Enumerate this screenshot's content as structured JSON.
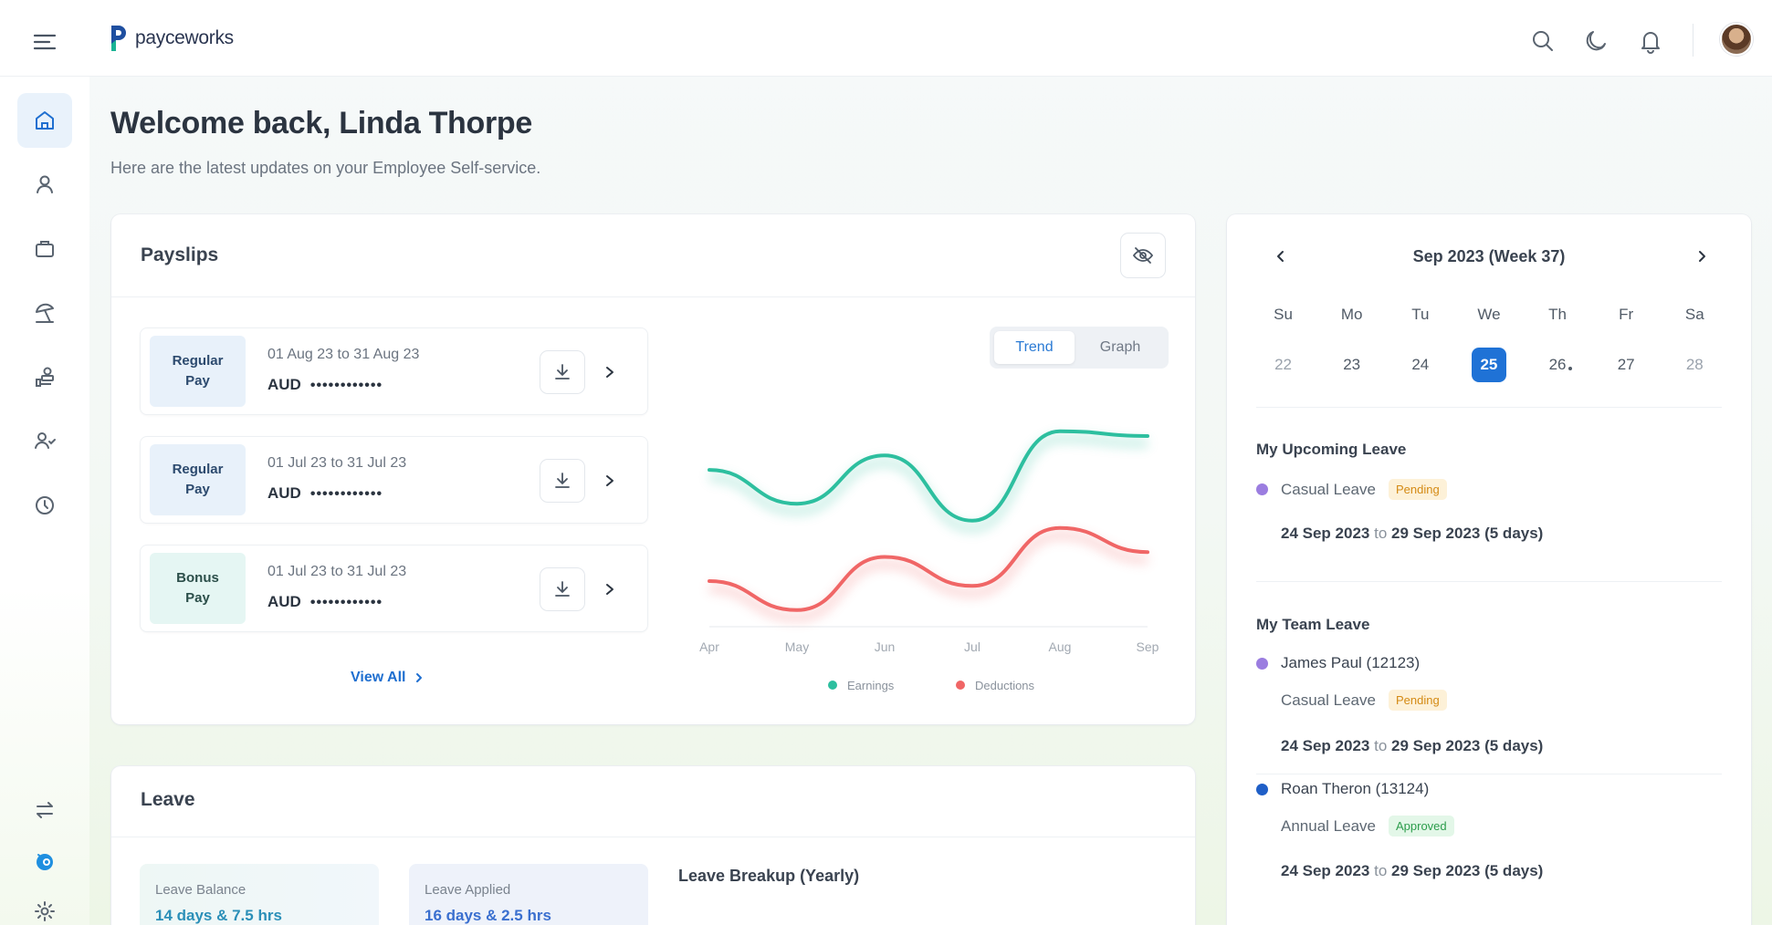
{
  "brand": {
    "name": "payceworks",
    "logo_color": "#1f4fa0"
  },
  "topbar": {
    "icons": [
      "search-icon",
      "moon-icon",
      "bell-icon"
    ]
  },
  "sidebar": {
    "items": [
      {
        "icon": "home-icon",
        "active": true
      },
      {
        "icon": "user-icon"
      },
      {
        "icon": "briefcase-icon"
      },
      {
        "icon": "beach-umbrella-icon"
      },
      {
        "icon": "hand-coins-icon"
      },
      {
        "icon": "users-icon"
      },
      {
        "icon": "clock-icon"
      }
    ],
    "bottom": [
      "swap-icon",
      "support-bot-icon",
      "gear-icon"
    ]
  },
  "welcome": {
    "title": "Welcome back, Linda Thorpe",
    "subtitle": "Here are the latest updates on your Employee Self-service."
  },
  "payslips": {
    "title": "Payslips",
    "items": [
      {
        "type_line1": "Regular",
        "type_line2": "Pay",
        "dates": "01 Aug 23 to 31 Aug 23",
        "currency": "AUD",
        "masked": "••••••••••••"
      },
      {
        "type_line1": "Regular",
        "type_line2": "Pay",
        "dates": "01 Jul 23 to 31 Jul 23",
        "currency": "AUD",
        "masked": "••••••••••••"
      },
      {
        "type_line1": "Bonus",
        "type_line2": "Pay",
        "dates": "01 Jul 23 to 31 Jul 23",
        "currency": "AUD",
        "masked": "••••••••••••"
      }
    ],
    "view_all": "View All",
    "toggle": {
      "trend": "Trend",
      "graph": "Graph"
    },
    "legend": {
      "earnings": "Earnings",
      "deductions": "Deductions"
    }
  },
  "chart_data": {
    "type": "line",
    "categories": [
      "Apr",
      "May",
      "Jun",
      "Jul",
      "Aug",
      "Sep"
    ],
    "series": [
      {
        "name": "Earnings",
        "color": "#2dbf9f",
        "values": [
          66,
          52,
          72,
          45,
          82,
          80
        ]
      },
      {
        "name": "Deductions",
        "color": "#f06666",
        "values": [
          20,
          8,
          30,
          18,
          42,
          32
        ]
      }
    ],
    "ylim": [
      0,
      100
    ],
    "grid": false,
    "legend": "bottom"
  },
  "leave": {
    "title": "Leave",
    "balance_label": "Leave Balance",
    "balance_value": "14 days & 7.5 hrs",
    "applied_label": "Leave Applied",
    "applied_value": "16 days & 2.5 hrs",
    "breakup_title": "Leave Breakup (Yearly)"
  },
  "calendar": {
    "title": "Sep 2023 (Week 37)",
    "dow": [
      "Su",
      "Mo",
      "Tu",
      "We",
      "Th",
      "Fr",
      "Sa"
    ],
    "days": [
      "22",
      "23",
      "24",
      "25",
      "26",
      "27",
      "28"
    ],
    "selected": "25"
  },
  "upcoming": {
    "title": "My Upcoming Leave",
    "type": "Casual Leave",
    "status": "Pending",
    "from": "24 Sep 2023",
    "to_word": "to",
    "to": "29 Sep 2023 (5 days)",
    "bullet_color": "#9b7de0"
  },
  "team": {
    "title": "My Team Leave",
    "members": [
      {
        "name": "James Paul (12123)",
        "type": "Casual Leave",
        "status": "Pending",
        "from": "24 Sep 2023",
        "to_word": "to",
        "to": "29 Sep 2023 (5 days)",
        "bullet_color": "#9b7de0"
      },
      {
        "name": "Roan Theron (13124)",
        "type": "Annual Leave",
        "status": "Approved",
        "from": "24 Sep 2023",
        "to_word": "to",
        "to": "29 Sep 2023 (5 days)",
        "bullet_color": "#1f5fc7"
      }
    ]
  }
}
